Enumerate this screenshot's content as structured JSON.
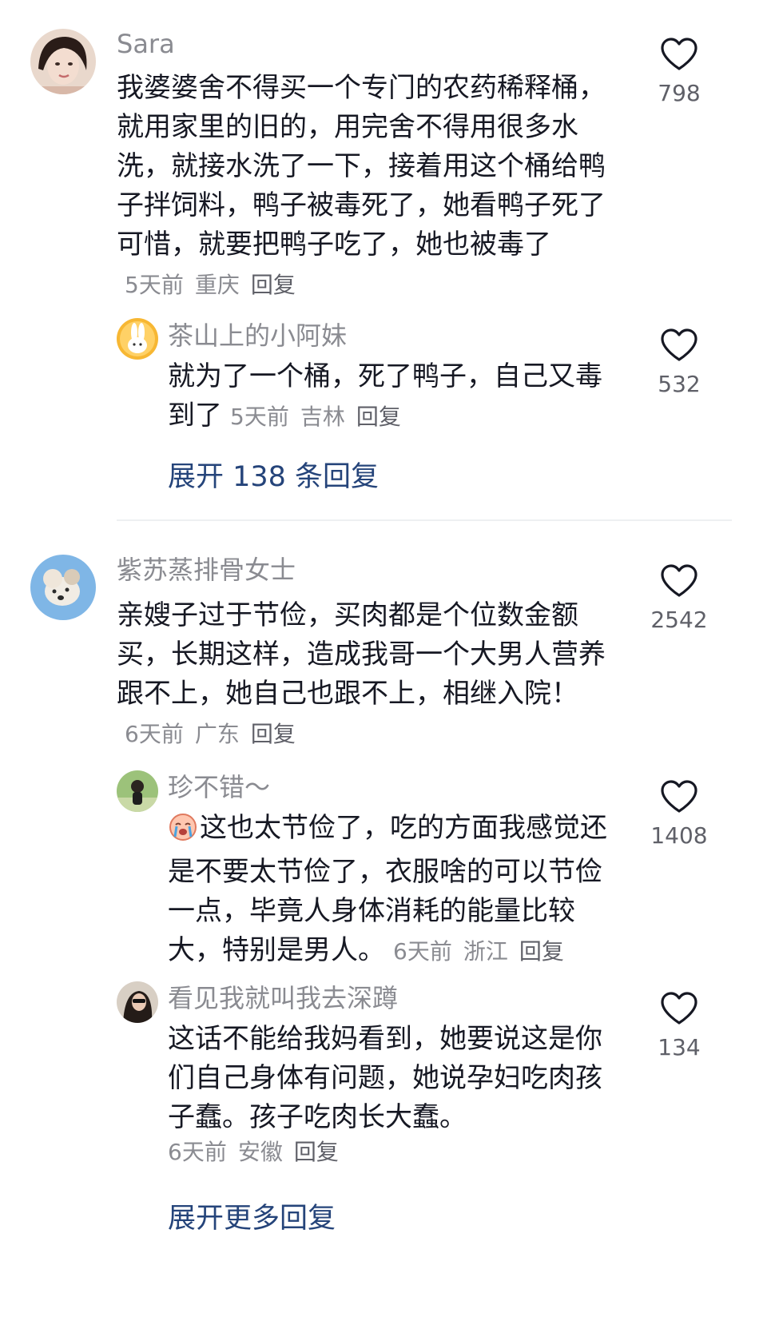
{
  "comments": [
    {
      "username": "Sara",
      "text": "我婆婆舍不得买一个专门的农药稀释桶，就用家里的旧的，用完舍不得用很多水洗，就接水洗了一下，接着用这个桶给鸭子拌饲料，鸭子被毒死了，她看鸭子死了可惜，就要把鸭子吃了，她也被毒了",
      "time": "5天前",
      "location": "重庆",
      "reply": "回复",
      "likes": "798",
      "replies": [
        {
          "username": "茶山上的小阿妹",
          "text": "就为了一个桶，死了鸭子，自己又毒到了",
          "time": "5天前",
          "location": "吉林",
          "reply": "回复",
          "likes": "532"
        }
      ],
      "expand": "展开 138 条回复"
    },
    {
      "username": "紫苏蒸排骨女士",
      "text": "亲嫂子过于节俭，买肉都是个位数金额买，长期这样，造成我哥一个大男人营养跟不上，她自己也跟不上，相继入院！",
      "time": "6天前",
      "location": "广东",
      "reply": "回复",
      "likes": "2542",
      "replies": [
        {
          "username": "珍不错～",
          "emoji_icon": "crying-face-icon",
          "text": "这也太节俭了，吃的方面我感觉还是不要太节俭了，衣服啥的可以节俭一点，毕竟人身体消耗的能量比较大，特别是男人。",
          "time": "6天前",
          "location": "浙江",
          "reply": "回复",
          "likes": "1408"
        },
        {
          "username": "看见我就叫我去深蹲",
          "text": "这话不能给我妈看到，她要说这是你们自己身体有问题，她说孕妇吃肉孩子蠢。孩子吃肉长大蠢。",
          "time": "6天前",
          "location": "安徽",
          "reply": "回复",
          "likes": "134"
        }
      ],
      "expand": "展开更多回复"
    }
  ],
  "colors": {
    "text": "#161823",
    "secondary": "#8a8b91",
    "link": "#25447a",
    "divider": "#eef0f2"
  }
}
